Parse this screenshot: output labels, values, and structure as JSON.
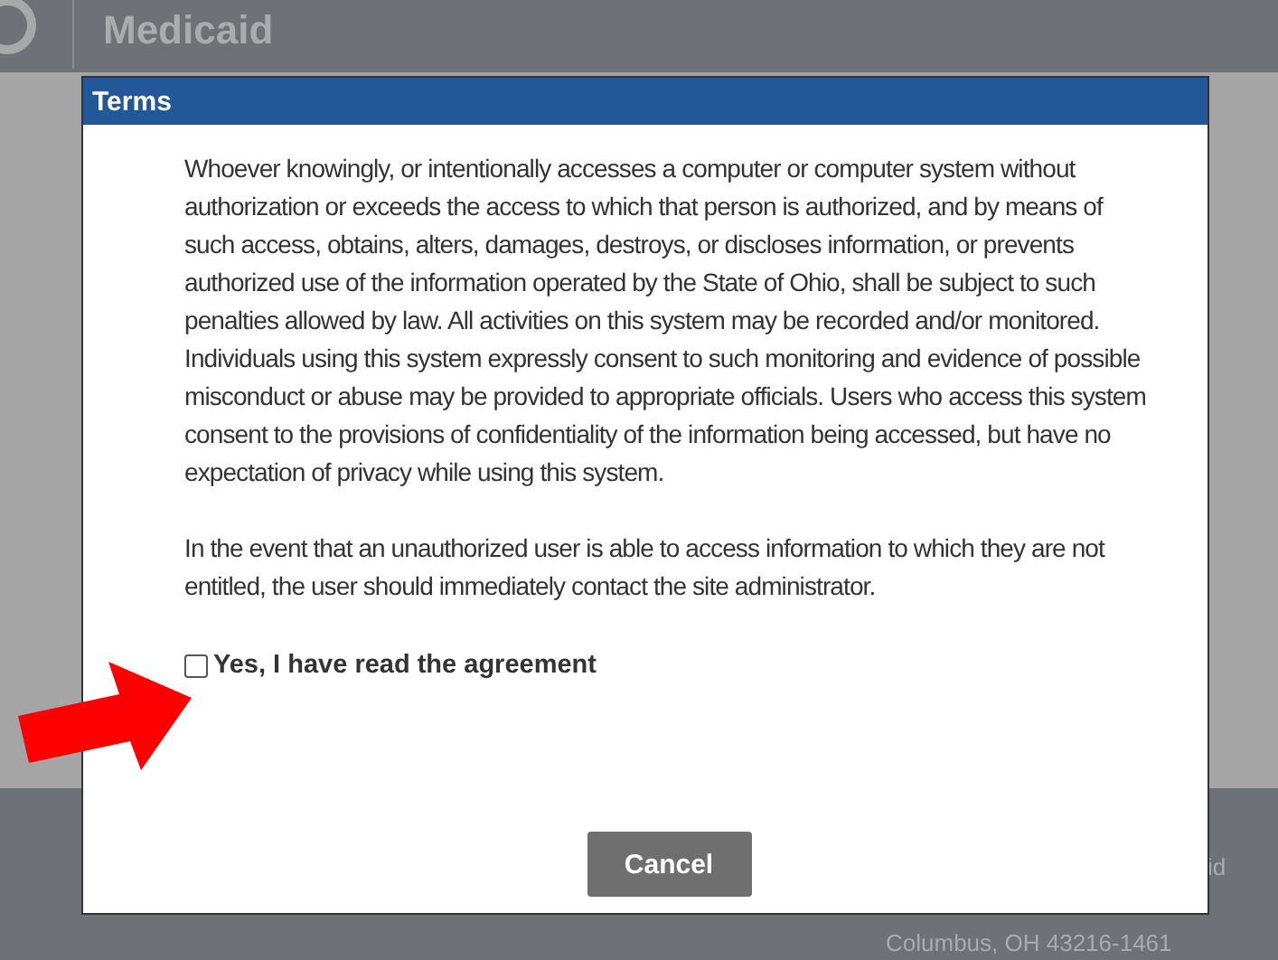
{
  "page": {
    "heading": "Medicaid",
    "footer_lines": [
      "Columbus, OH 43216-1461"
    ],
    "footer_side": "id"
  },
  "dialog": {
    "title": "Terms",
    "paragraphs": [
      "Whoever knowingly, or intentionally accesses a computer or computer system without authorization or exceeds the access to which that person is authorized, and by means of such access, obtains, alters, damages, destroys, or discloses information, or prevents authorized use of the information operated by the State of Ohio, shall be subject to such penalties allowed by law. All activities on this system may be recorded and/or monitored. Individuals using this system expressly consent to such monitoring and evidence of possible misconduct or abuse may be provided to appropriate officials. Users who access this system consent to the provisions of confidentiality of the information being accessed, but have no expectation of privacy while using this system.",
      "In the event that an unauthorized user is able to access information to which they are not entitled, the user should immediately contact the site administrator."
    ],
    "agreement": {
      "label": "Yes, I have read the agreement",
      "checked": false
    },
    "buttons": [
      "Cancel"
    ]
  }
}
